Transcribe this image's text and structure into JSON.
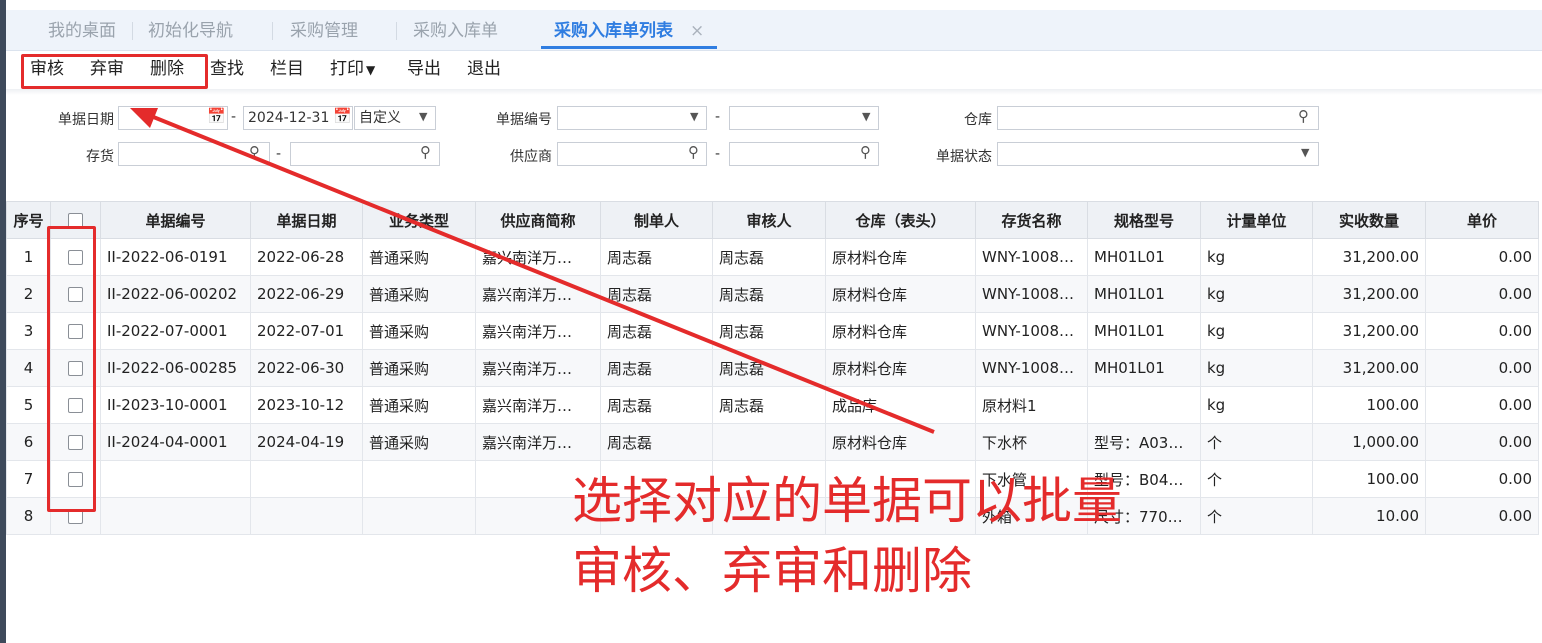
{
  "tabs": [
    {
      "label": "我的桌面"
    },
    {
      "label": "初始化导航"
    },
    {
      "label": "采购管理"
    },
    {
      "label": "采购入库单"
    },
    {
      "label": "采购入库单列表",
      "active": true
    }
  ],
  "tab_close": "×",
  "toolbar": {
    "approve": "审核",
    "unapprove": "弃审",
    "delete": "删除",
    "find": "查找",
    "columns": "栏目",
    "print": "打印",
    "export": "导出",
    "exit": "退出"
  },
  "filters": {
    "date_label": "单据日期",
    "date_from": "",
    "date_to": "2024-12-31",
    "date_mode": "自定义",
    "code_label": "单据编号",
    "warehouse_label": "仓库",
    "stock_label": "存货",
    "supplier_label": "供应商",
    "status_label": "单据状态",
    "dash": "-"
  },
  "table": {
    "headers": [
      "序号",
      "",
      "单据编号",
      "单据日期",
      "业务类型",
      "供应商简称",
      "制单人",
      "审核人",
      "仓库（表头）",
      "存货名称",
      "规格型号",
      "计量单位",
      "实收数量",
      "单价"
    ],
    "rows": [
      [
        "1",
        "",
        "II-2022-06-0191",
        "2022-06-28",
        "普通采购",
        "嘉兴南洋万…",
        "周志磊",
        "周志磊",
        "原材料仓库",
        "WNY-1008…",
        "MH01L01",
        "kg",
        "31,200.00",
        "0.00"
      ],
      [
        "2",
        "",
        "II-2022-06-00202",
        "2022-06-29",
        "普通采购",
        "嘉兴南洋万…",
        "周志磊",
        "周志磊",
        "原材料仓库",
        "WNY-1008…",
        "MH01L01",
        "kg",
        "31,200.00",
        "0.00"
      ],
      [
        "3",
        "",
        "II-2022-07-0001",
        "2022-07-01",
        "普通采购",
        "嘉兴南洋万…",
        "周志磊",
        "周志磊",
        "原材料仓库",
        "WNY-1008…",
        "MH01L01",
        "kg",
        "31,200.00",
        "0.00"
      ],
      [
        "4",
        "",
        "II-2022-06-00285",
        "2022-06-30",
        "普通采购",
        "嘉兴南洋万…",
        "周志磊",
        "周志磊",
        "原材料仓库",
        "WNY-1008…",
        "MH01L01",
        "kg",
        "31,200.00",
        "0.00"
      ],
      [
        "5",
        "",
        "II-2023-10-0001",
        "2023-10-12",
        "普通采购",
        "嘉兴南洋万…",
        "周志磊",
        "周志磊",
        "成品库",
        "原材料1",
        "",
        "kg",
        "100.00",
        "0.00"
      ],
      [
        "6",
        "",
        "II-2024-04-0001",
        "2024-04-19",
        "普通采购",
        "嘉兴南洋万…",
        "周志磊",
        "",
        "原材料仓库",
        "下水杯",
        "型号：A03…",
        "个",
        "1,000.00",
        "0.00"
      ],
      [
        "7",
        "",
        "",
        "",
        "",
        "",
        "",
        "",
        "",
        "下水管",
        "型号：B04…",
        "个",
        "100.00",
        "0.00"
      ],
      [
        "8",
        "",
        "",
        "",
        "",
        "",
        "",
        "",
        "",
        "外箱",
        "尺寸：770…",
        "个",
        "10.00",
        "0.00"
      ]
    ]
  },
  "annotation": {
    "line1": "选择对应的单据可以批量",
    "line2": "审核、弃审和删除"
  },
  "colors": {
    "accent": "#2f7de1",
    "annotation_red": "#e42b2b"
  },
  "icons": {
    "calendar": "calendar-icon",
    "search": "search-icon",
    "dropdown": "chevron-down-icon"
  }
}
